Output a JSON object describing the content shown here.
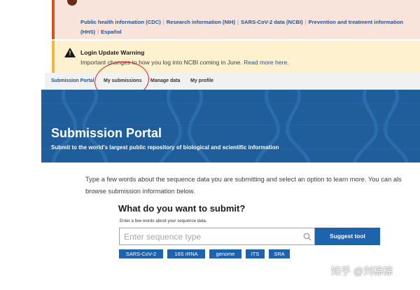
{
  "covid_banner": {
    "links": [
      "Public health information (CDC)",
      "Research information (NIH)",
      "SARS-CoV-2 data (NCBI)",
      "Prevention and treatment information (HHS)",
      "Español"
    ],
    "separator": "|"
  },
  "login_banner": {
    "title": "Login Update Warning",
    "text": "Important changes to how you log into NCBI coming in June.",
    "link": "Read more here."
  },
  "nav": {
    "items": [
      "Submission Portal",
      "My submissions",
      "Manage data",
      "My profile"
    ]
  },
  "hero": {
    "title": "Submission Portal",
    "subtitle": "Submit to the world's largest public repository of biological and scientific information"
  },
  "intro": {
    "text": "Type a few words about the sequence data you are submitting and select an option to learn more. You can als browse submission information below."
  },
  "submit": {
    "heading": "What do you want to submit?",
    "hint": "Enter a few words about your sequence data.",
    "search_placeholder": "Enter sequence type",
    "button": "Suggest tool",
    "tags": [
      "SARS-CoV-2",
      "16S rRNA",
      "genome",
      "ITS",
      "SRA"
    ]
  },
  "watermark": "知乎 @刘棕棕",
  "colors": {
    "accent": "#1d63ad",
    "hero_bg": "#1f5e9b",
    "covid_bg": "#f9e4dc",
    "warning_bg": "#fdf1cf",
    "annotation_circle": "#d01c1c"
  }
}
